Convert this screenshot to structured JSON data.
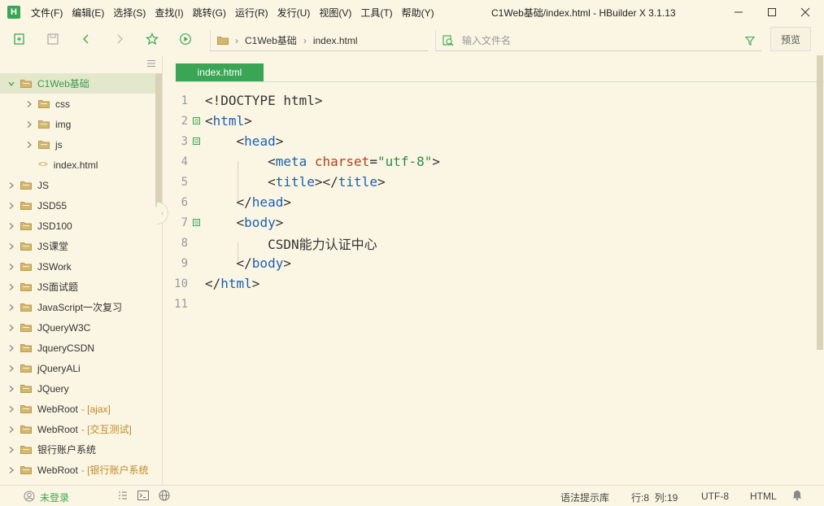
{
  "app": {
    "logo_letter": "H",
    "window_title": "C1Web基础/index.html - HBuilder X 3.1.13"
  },
  "menu": [
    {
      "label": "文件(F)"
    },
    {
      "label": "编辑(E)"
    },
    {
      "label": "选择(S)"
    },
    {
      "label": "查找(I)"
    },
    {
      "label": "跳转(G)"
    },
    {
      "label": "运行(R)"
    },
    {
      "label": "发行(U)"
    },
    {
      "label": "视图(V)"
    },
    {
      "label": "工具(T)"
    },
    {
      "label": "帮助(Y)"
    }
  ],
  "toolbar": {
    "breadcrumb": [
      "C1Web基础",
      "index.html"
    ],
    "search_placeholder": "输入文件名",
    "preview_label": "预览"
  },
  "sidebar": {
    "items": [
      {
        "label": "C1Web基础",
        "suffix": "",
        "expanded": true,
        "selected": true,
        "level": 0,
        "kind": "folder"
      },
      {
        "label": "css",
        "suffix": "",
        "level": 1,
        "kind": "folder"
      },
      {
        "label": "img",
        "suffix": "",
        "level": 1,
        "kind": "folder"
      },
      {
        "label": "js",
        "suffix": "",
        "level": 1,
        "kind": "folder"
      },
      {
        "label": "index.html",
        "suffix": "",
        "level": 1,
        "kind": "file"
      },
      {
        "label": "JS",
        "suffix": "",
        "level": 0,
        "kind": "folder"
      },
      {
        "label": "JSD55",
        "suffix": "",
        "level": 0,
        "kind": "folder"
      },
      {
        "label": "JSD100",
        "suffix": "",
        "level": 0,
        "kind": "folder"
      },
      {
        "label": "JS课堂",
        "suffix": "",
        "level": 0,
        "kind": "folder"
      },
      {
        "label": "JSWork",
        "suffix": "",
        "level": 0,
        "kind": "folder"
      },
      {
        "label": "JS面试题",
        "suffix": "",
        "level": 0,
        "kind": "folder"
      },
      {
        "label": "JavaScript一次复习",
        "suffix": "",
        "level": 0,
        "kind": "folder"
      },
      {
        "label": "JQueryW3C",
        "suffix": "",
        "level": 0,
        "kind": "folder"
      },
      {
        "label": "JqueryCSDN",
        "suffix": "",
        "level": 0,
        "kind": "folder"
      },
      {
        "label": "jQueryALi",
        "suffix": "",
        "level": 0,
        "kind": "folder"
      },
      {
        "label": "JQuery",
        "suffix": "",
        "level": 0,
        "kind": "folder"
      },
      {
        "label": "WebRoot",
        "suffix": "- [ajax]",
        "level": 0,
        "kind": "folder"
      },
      {
        "label": "WebRoot",
        "suffix": "- [交互测试]",
        "level": 0,
        "kind": "folder"
      },
      {
        "label": "银行账户系统",
        "suffix": "",
        "level": 0,
        "kind": "folder"
      },
      {
        "label": "WebRoot",
        "suffix": "- [银行账户系统",
        "level": 0,
        "kind": "folder"
      }
    ]
  },
  "editor": {
    "tab_label": "index.html",
    "lines": [
      {
        "n": "1",
        "fold": "",
        "parts": [
          [
            "p",
            "<!DOCTYPE html>"
          ]
        ]
      },
      {
        "n": "2",
        "fold": "⊟",
        "parts": [
          [
            "p",
            "<"
          ],
          [
            "t",
            "html"
          ],
          [
            "p",
            ">"
          ]
        ]
      },
      {
        "n": "3",
        "fold": "⊟",
        "parts": [
          [
            "p",
            "    <"
          ],
          [
            "t",
            "head"
          ],
          [
            "p",
            ">"
          ]
        ]
      },
      {
        "n": "4",
        "fold": "",
        "parts": [
          [
            "p",
            "        <"
          ],
          [
            "t",
            "meta"
          ],
          [
            "p",
            " "
          ],
          [
            "a",
            "charset"
          ],
          [
            "p",
            "="
          ],
          [
            "s",
            "\"utf-8\""
          ],
          [
            "p",
            ">"
          ]
        ]
      },
      {
        "n": "5",
        "fold": "",
        "parts": [
          [
            "p",
            "        <"
          ],
          [
            "t",
            "title"
          ],
          [
            "p",
            "></"
          ],
          [
            "t",
            "title"
          ],
          [
            "p",
            ">"
          ]
        ]
      },
      {
        "n": "6",
        "fold": "",
        "parts": [
          [
            "p",
            "    </"
          ],
          [
            "t",
            "head"
          ],
          [
            "p",
            ">"
          ]
        ]
      },
      {
        "n": "7",
        "fold": "⊟",
        "parts": [
          [
            "p",
            "    <"
          ],
          [
            "t",
            "body"
          ],
          [
            "p",
            ">"
          ]
        ]
      },
      {
        "n": "8",
        "fold": "",
        "parts": [
          [
            "p",
            "        CSDN能力认证中心"
          ]
        ]
      },
      {
        "n": "9",
        "fold": "",
        "parts": [
          [
            "p",
            "    </"
          ],
          [
            "t",
            "body"
          ],
          [
            "p",
            ">"
          ]
        ]
      },
      {
        "n": "10",
        "fold": "",
        "parts": [
          [
            "p",
            "</"
          ],
          [
            "t",
            "html"
          ],
          [
            "p",
            ">"
          ]
        ]
      },
      {
        "n": "11",
        "fold": "",
        "parts": []
      }
    ]
  },
  "status": {
    "login": "未登录",
    "syntax_hint": "语法提示库",
    "row_col": "行:8  列:19",
    "encoding": "UTF-8",
    "language": "HTML"
  },
  "colors": {
    "accent": "#3aa655",
    "background": "#fbf6e3",
    "selected_row": "#e3e8cd",
    "tag": "#1a5fb4",
    "attribute": "#b5401a",
    "string": "#2d8a4f",
    "suffix": "#c08a2b"
  }
}
